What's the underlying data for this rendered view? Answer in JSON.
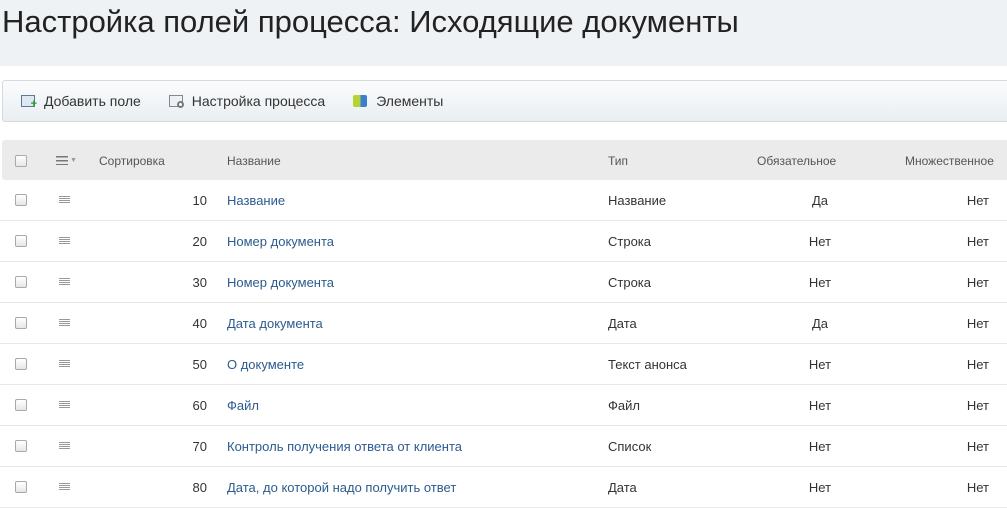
{
  "title": "Настройка полей процесса: Исходящие документы",
  "toolbar": [
    {
      "label": "Добавить поле",
      "icon": "add-field-icon"
    },
    {
      "label": "Настройка процесса",
      "icon": "process-settings-icon"
    },
    {
      "label": "Элементы",
      "icon": "elements-icon"
    }
  ],
  "columns": {
    "sort": "Сортировка",
    "name": "Название",
    "type": "Тип",
    "required": "Обязательное",
    "multiple": "Множественное"
  },
  "rows": [
    {
      "sort": "10",
      "name": "Название",
      "type": "Название",
      "required": "Да",
      "multiple": "Нет"
    },
    {
      "sort": "20",
      "name": "Номер документа",
      "type": "Строка",
      "required": "Нет",
      "multiple": "Нет"
    },
    {
      "sort": "30",
      "name": "Номер документа",
      "type": "Строка",
      "required": "Нет",
      "multiple": "Нет"
    },
    {
      "sort": "40",
      "name": "Дата документа",
      "type": "Дата",
      "required": "Да",
      "multiple": "Нет"
    },
    {
      "sort": "50",
      "name": "О документе",
      "type": "Текст анонса",
      "required": "Нет",
      "multiple": "Нет"
    },
    {
      "sort": "60",
      "name": "Файл",
      "type": "Файл",
      "required": "Нет",
      "multiple": "Нет"
    },
    {
      "sort": "70",
      "name": "Контроль получения ответа от клиента",
      "type": "Список",
      "required": "Нет",
      "multiple": "Нет"
    },
    {
      "sort": "80",
      "name": "Дата, до которой надо получить ответ",
      "type": "Дата",
      "required": "Нет",
      "multiple": "Нет"
    }
  ]
}
